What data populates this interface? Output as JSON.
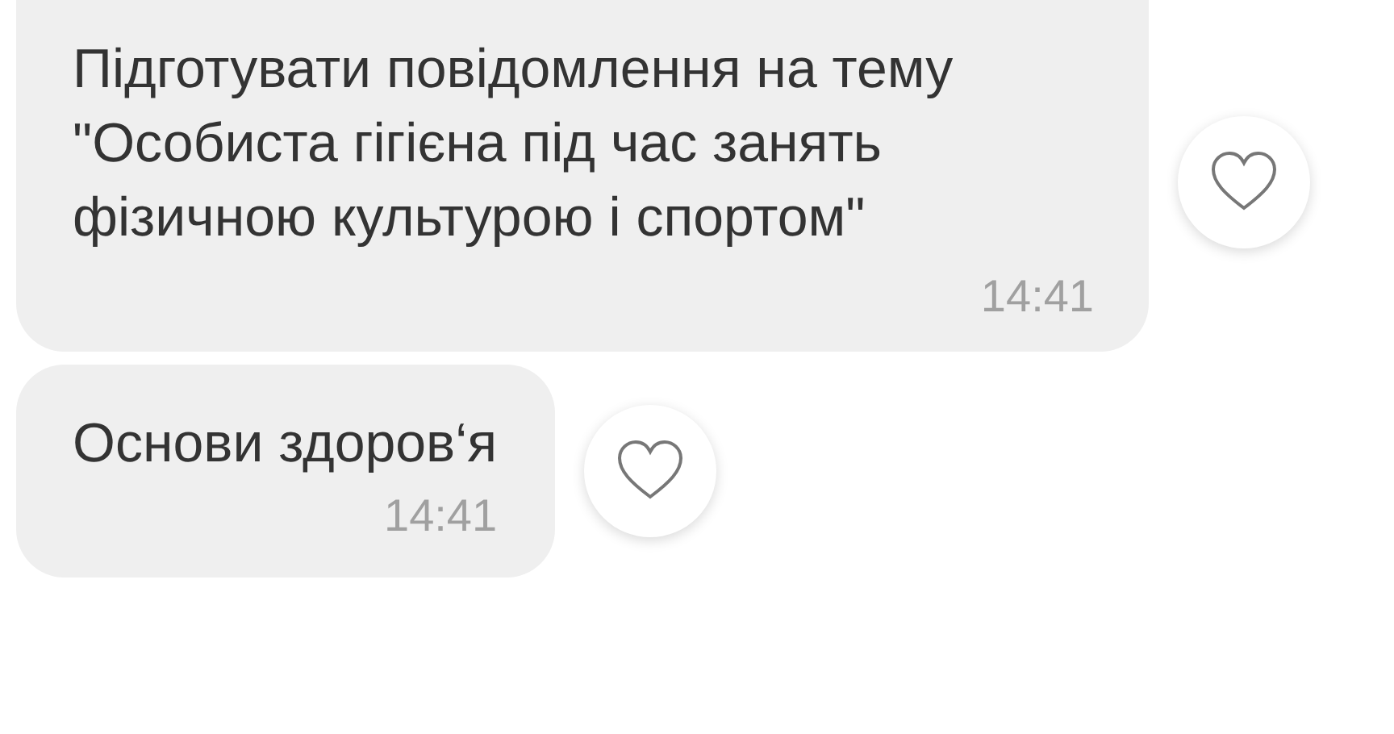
{
  "messages": [
    {
      "text": "Підготувати повідомлення на тему \"Особиста гігієна під час занять фізичною культурою і спортом\"",
      "time": "14:41",
      "liked": false
    },
    {
      "text": "Основи здоров‘я",
      "time": "14:41",
      "liked": false
    }
  ]
}
